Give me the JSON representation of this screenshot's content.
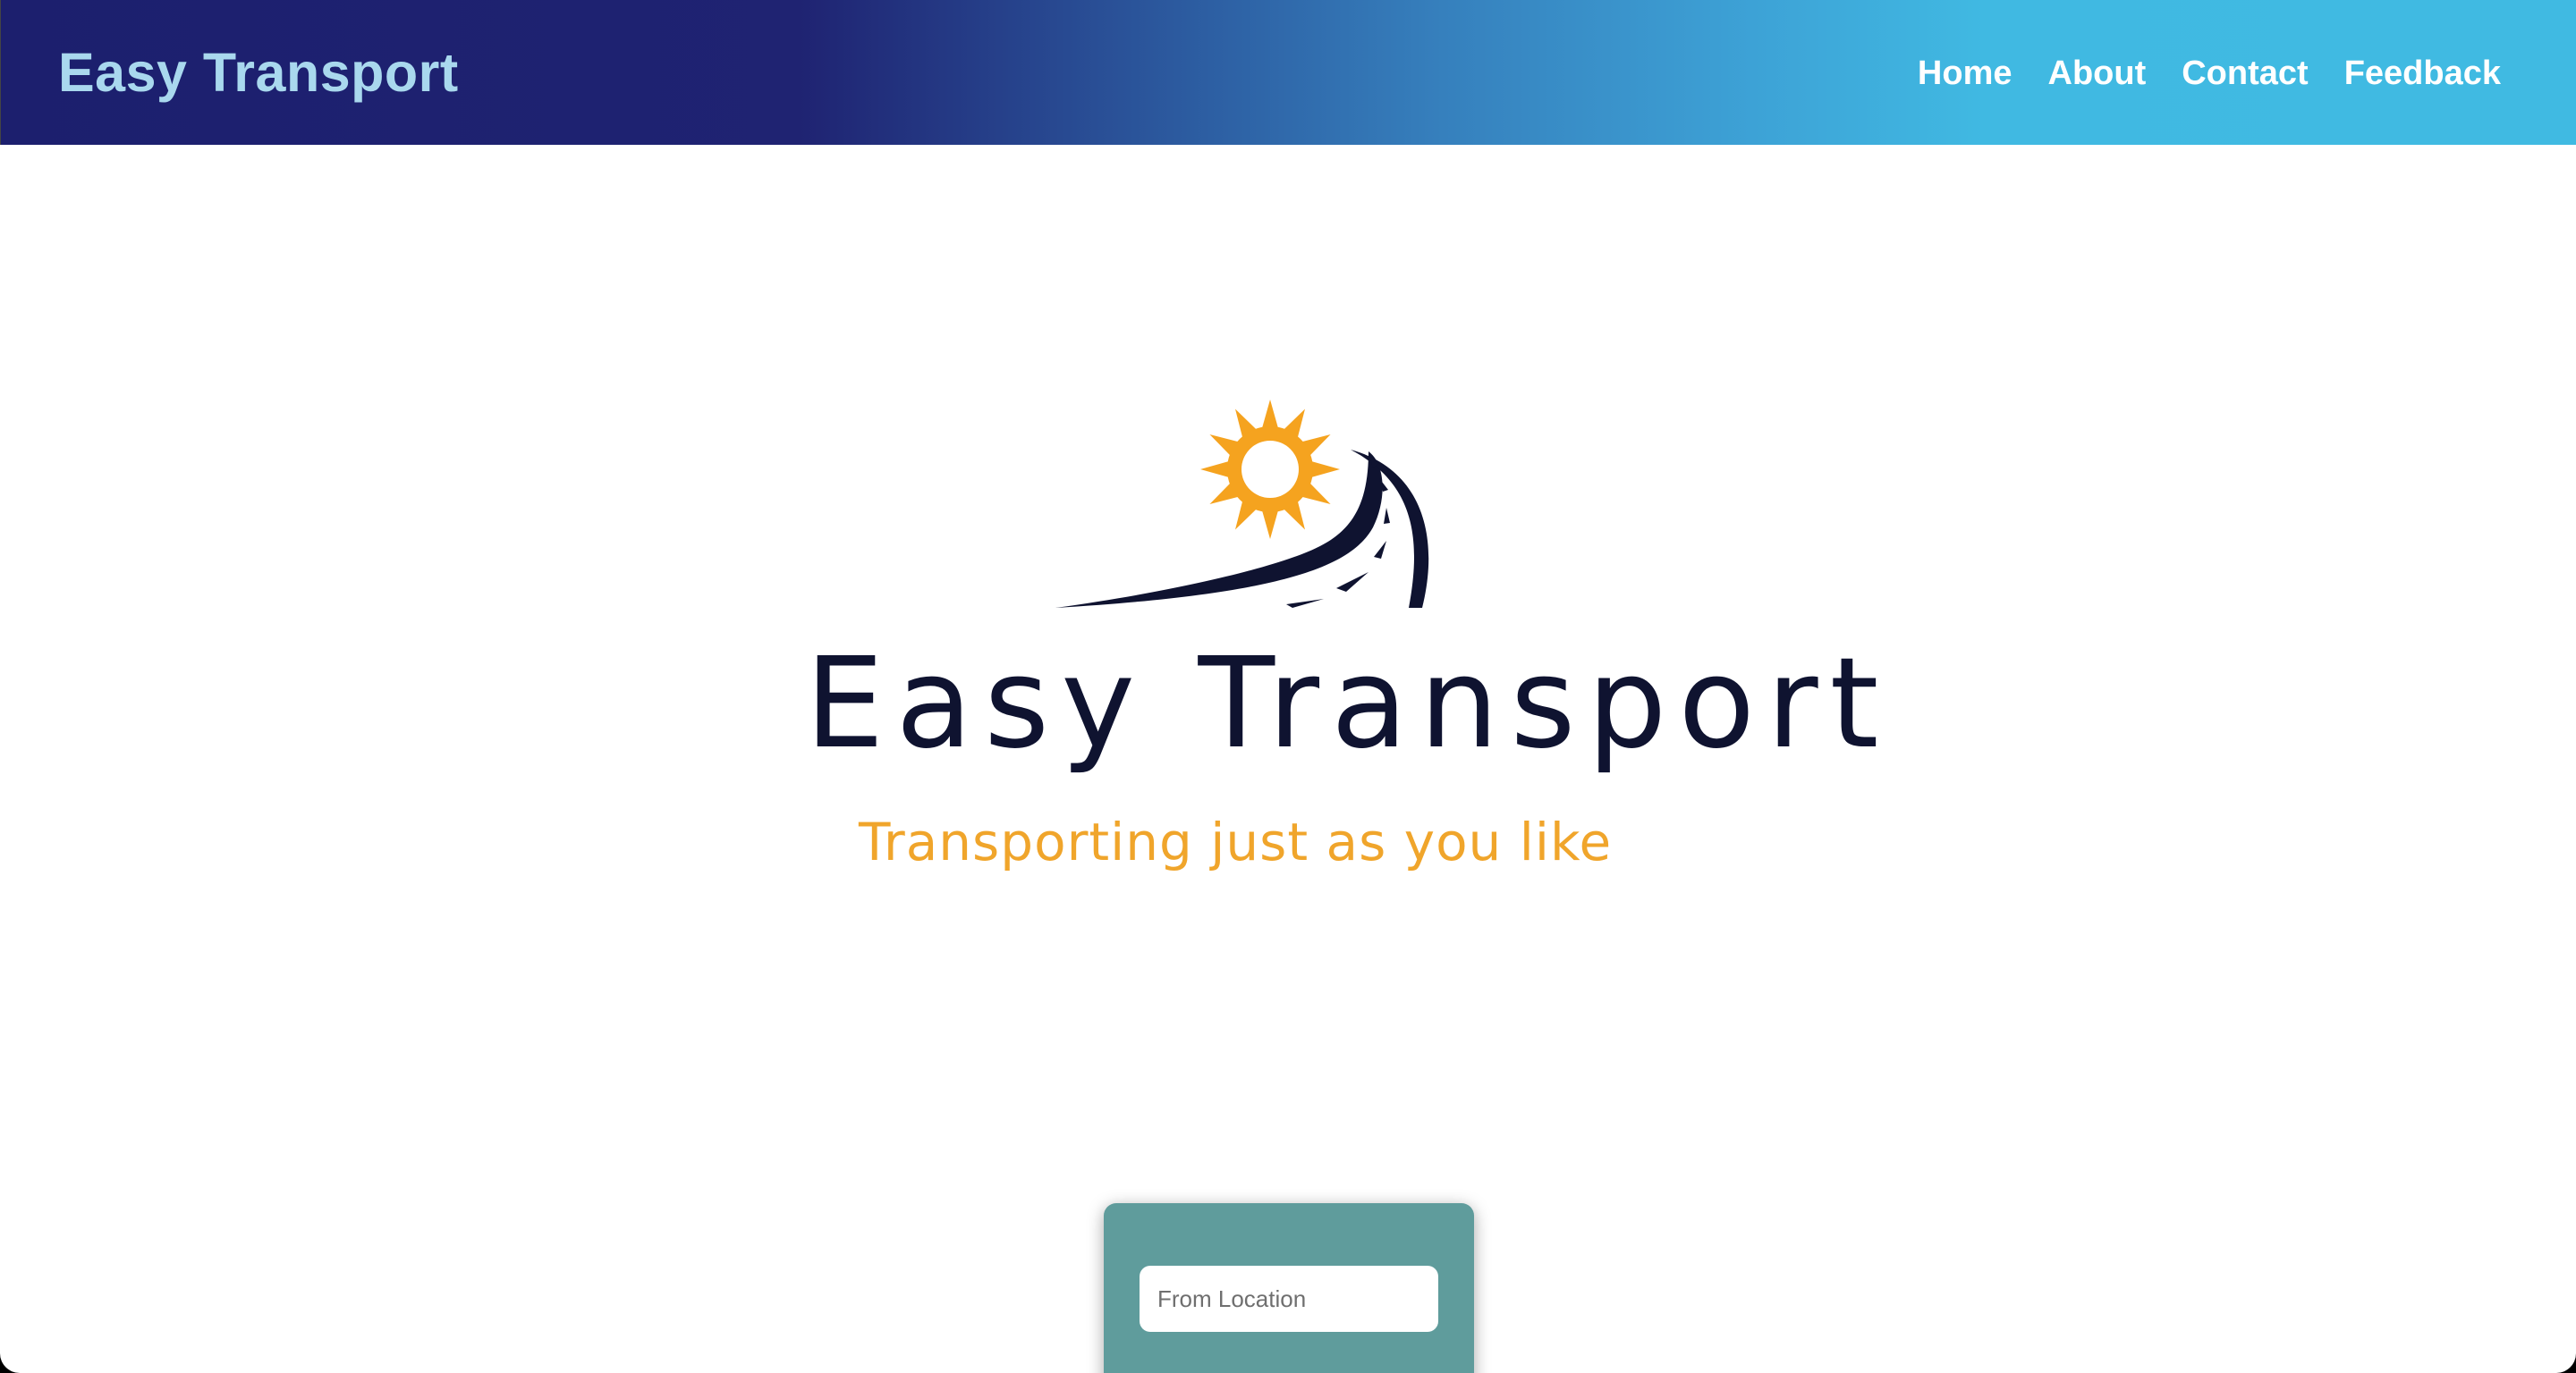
{
  "navbar": {
    "brand": "Easy Transport",
    "links": [
      {
        "label": "Home"
      },
      {
        "label": "About"
      },
      {
        "label": "Contact"
      },
      {
        "label": "Feedback"
      }
    ],
    "gradient_colors": [
      "#1c1f6e",
      "#3680bd",
      "#40bae2"
    ]
  },
  "hero": {
    "logo_title": "Easy Transport",
    "logo_tagline": "Transporting just as you like",
    "logo_icons": [
      "sun-icon",
      "road-icon"
    ],
    "colors": {
      "sun": "#f5a31f",
      "road": "#0f1330",
      "tagline": "#f0a52b"
    }
  },
  "search": {
    "from_value": "",
    "from_placeholder": "From Location",
    "card_color": "#5f9c9c"
  }
}
